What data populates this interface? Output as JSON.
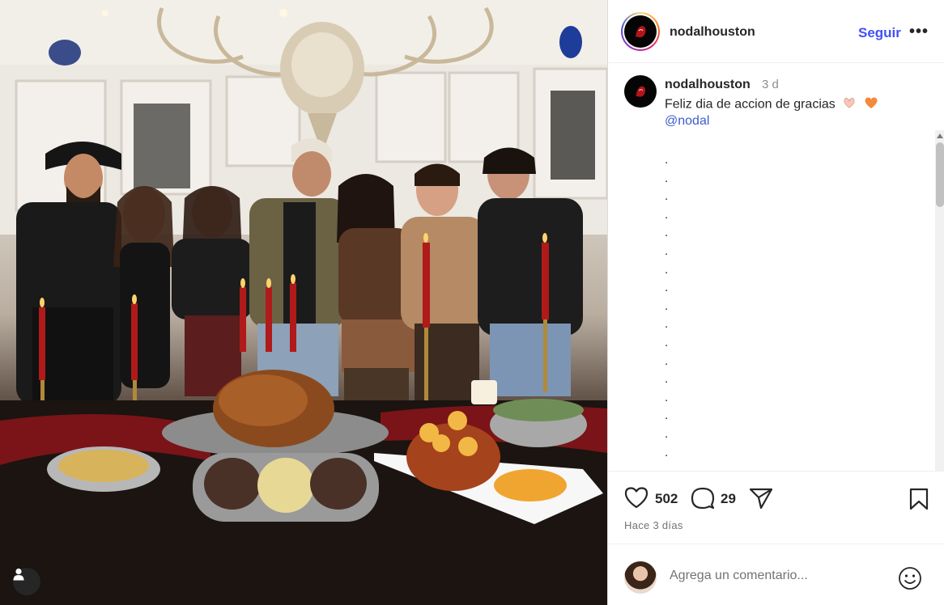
{
  "post": {
    "username": "nodalhouston",
    "follow_label": "Seguir",
    "more_label": "•••"
  },
  "caption": {
    "username": "nodalhouston",
    "time": "3 d",
    "text": "Feliz dia de accion de gracias",
    "emojis": [
      "heart-hands-icon",
      "orange-heart-icon"
    ],
    "mention": "@nodal",
    "dot_lines": [
      ".",
      ".",
      ".",
      ".",
      ".",
      ".",
      ".",
      ".",
      ".",
      ".",
      ".",
      ".",
      ".",
      ".",
      ".",
      ".",
      ".",
      "."
    ]
  },
  "actions": {
    "likes": "502",
    "comments": "29",
    "posted": "Hace 3 días"
  },
  "add_comment": {
    "placeholder": "Agrega un comentario..."
  },
  "colors": {
    "accent_link": "#4150f7",
    "text": "#262626",
    "muted": "#737373",
    "divider": "#efefef"
  }
}
